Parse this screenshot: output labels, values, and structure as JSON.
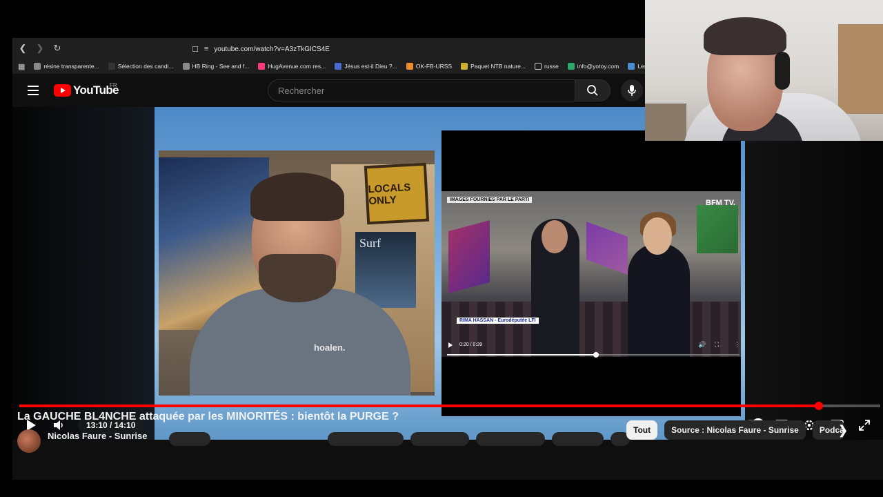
{
  "browser": {
    "url": "youtube.com/watch?v=A3zTkGICS4E",
    "bookmarks": [
      {
        "label": "résine transparente...",
        "color": "#8a8a8a"
      },
      {
        "label": "Sélection des candi...",
        "color": "#333333"
      },
      {
        "label": "HB Ring - See and f...",
        "color": "#8a8a8a"
      },
      {
        "label": "HugAvenue.com res...",
        "color": "#ff3a7a"
      },
      {
        "label": "Jésus est-il Dieu ?...",
        "color": "#4a6ad0"
      },
      {
        "label": "OK-FB-URSS",
        "color": "#f08a2a"
      },
      {
        "label": "Paquet NTB nature...",
        "color": "#d0b030"
      },
      {
        "label": "russe",
        "color": "#1f1f1f"
      },
      {
        "label": "info@yotoy.com",
        "color": "#2aa86a"
      },
      {
        "label": "Les concours",
        "color": "#4a8ad0"
      }
    ]
  },
  "youtube": {
    "logo_text": "YouTube",
    "region": "FR",
    "search_placeholder": "Rechercher"
  },
  "video": {
    "poster_title": "LOCALS ONLY",
    "book_title": "Surf",
    "shirt_text": "hoalen.",
    "clip": {
      "source_tag": "IMAGES FOURNIES PAR LE PARTI",
      "channel_tag": "BFM TV.",
      "lower_third": "RIMA HASSAN - Eurodéputée LFI",
      "time": "0:20 / 0:39",
      "progress_fraction": 0.51
    }
  },
  "player": {
    "time": "13:10 / 14:10",
    "progress_fraction": 0.929
  },
  "title": "La GAUCHE BL4NCHE attaquée par les MINORITÉS : bientôt la PURGE ?",
  "channel_name": "Nicolas Faure - Sunrise",
  "chips": [
    {
      "label": "Tout",
      "active": true
    },
    {
      "label": "Source : Nicolas Faure - Sunrise",
      "active": false
    },
    {
      "label": "Podcasts",
      "active": false
    }
  ],
  "colors": {
    "accent": "#ff0000",
    "background": "#0f0f0f"
  }
}
